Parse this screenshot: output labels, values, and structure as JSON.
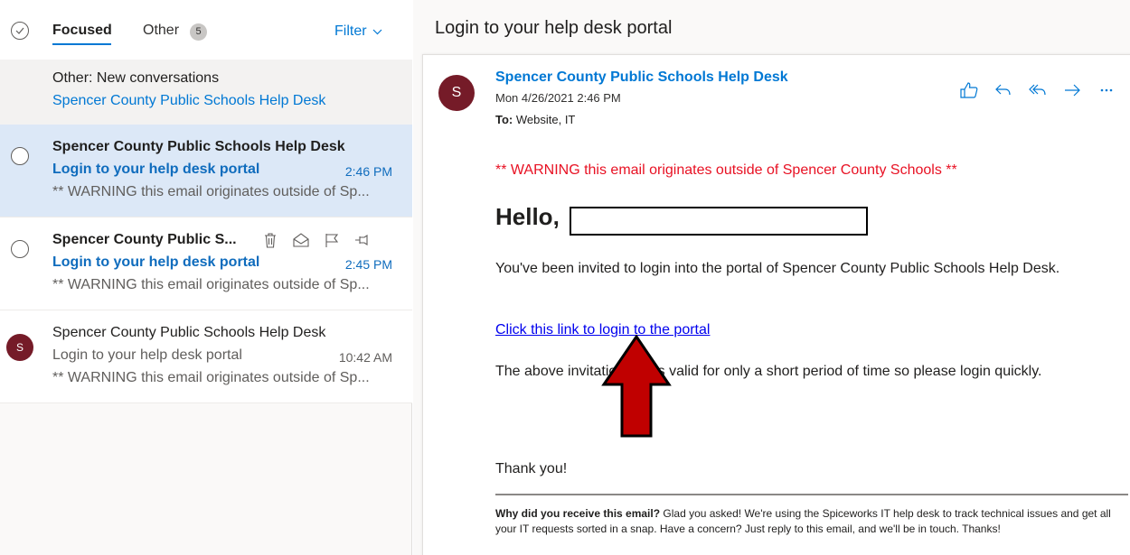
{
  "tabs": {
    "focused": "Focused",
    "other": "Other",
    "other_count": "5",
    "filter": "Filter"
  },
  "info_row": {
    "title": "Other: New conversations",
    "sender": "Spencer County Public Schools Help Desk"
  },
  "messages": [
    {
      "sender": "Spencer County Public Schools Help Desk",
      "subject": "Login to your help desk portal",
      "time": "2:46 PM",
      "preview": "** WARNING this email originates outside of Sp..."
    },
    {
      "sender": "Spencer County Public S...",
      "subject": "Login to your help desk portal",
      "time": "2:45 PM",
      "preview": "** WARNING this email originates outside of Sp..."
    },
    {
      "avatar": "S",
      "sender": "Spencer County Public Schools Help Desk",
      "subject": "Login to your help desk portal",
      "time": "10:42 AM",
      "preview": "** WARNING this email originates outside of Sp..."
    }
  ],
  "reading": {
    "subject": "Login to your help desk portal",
    "avatar": "S",
    "from": "Spencer County Public Schools Help Desk",
    "date": "Mon 4/26/2021 2:46 PM",
    "to_label": "To:",
    "to_value": "Website, IT",
    "warning": "** WARNING this email originates outside of Spencer County Schools **",
    "hello": "Hello,",
    "body1": "You've been invited to login into the portal of Spencer County Public Schools Help Desk.",
    "link": "Click this link to login to the portal",
    "body2": "The above invitation link is valid for only a short period of time so please login quickly.",
    "thanks": "Thank you!",
    "footer_bold": "Why did you receive this email?",
    "footer_text": " Glad you asked! We're using the Spiceworks IT help desk to track technical issues and get all your IT requests sorted in a snap. Have a concern? Just reply to this email, and we'll be in touch. Thanks!"
  },
  "colors": {
    "accent": "#0078d4",
    "warning": "#e81123",
    "avatar": "#751b28",
    "selected_row": "#dce8f7",
    "arrow": "#c00000"
  },
  "icons": [
    "select-all-icon",
    "chevron-down-icon",
    "delete-icon",
    "mark-read-icon",
    "flag-icon",
    "pin-icon",
    "like-icon",
    "reply-icon",
    "reply-all-icon",
    "forward-icon",
    "more-icon"
  ]
}
